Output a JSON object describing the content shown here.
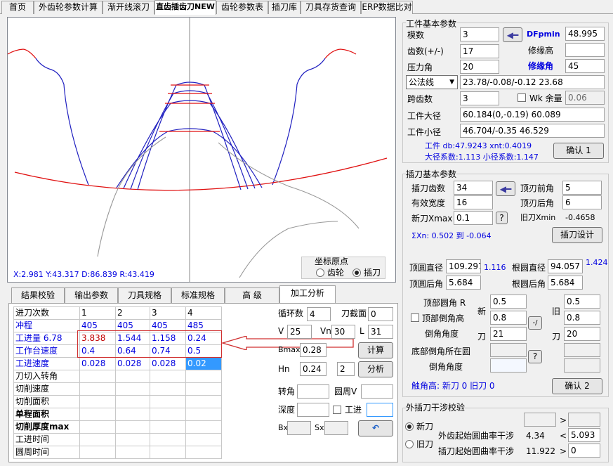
{
  "tabs": [
    "首页",
    "外齿轮参数计算",
    "渐开线滚刀",
    "直齿插齿刀NEW",
    "齿轮参数表",
    "插刀库",
    "刀具存货查询",
    "ERP数据比对"
  ],
  "canvas": {
    "coords_label": "X:2.981  Y:43.317  D:86.839  R:43.419",
    "origin_title": "坐标原点",
    "origin_gear": "齿轮",
    "origin_cutter": "插刀"
  },
  "bottom_tabs": [
    "结果校验",
    "输出参数",
    "刀具规格",
    "标准规格",
    "高 级",
    "加工分析"
  ],
  "table": {
    "headers": [
      "进刀次数",
      "1",
      "2",
      "3",
      "4"
    ],
    "rows": [
      {
        "label": "冲程",
        "values": [
          "405",
          "405",
          "405",
          "485"
        ]
      },
      {
        "label": "工进量 6.78",
        "values": [
          "3.838",
          "1.544",
          "1.158",
          "0.24"
        ]
      },
      {
        "label": "工作台速度",
        "values": [
          "0.4",
          "0.64",
          "0.74",
          "0.5"
        ]
      },
      {
        "label": "工进速度",
        "values": [
          "0.028",
          "0.028",
          "0.028",
          "0.02"
        ]
      },
      {
        "label": "刀切入转角",
        "values": [
          "",
          "",
          "",
          ""
        ]
      },
      {
        "label": "切削速度",
        "values": [
          "",
          "",
          "",
          ""
        ]
      },
      {
        "label": "切削面积",
        "values": [
          "",
          "",
          "",
          ""
        ]
      },
      {
        "label": "单程面积",
        "values": [
          "",
          "",
          "",
          ""
        ]
      },
      {
        "label": "切削厚度max",
        "values": [
          "",
          "",
          "",
          ""
        ]
      },
      {
        "label": "工进时间",
        "values": [
          "",
          "",
          "",
          ""
        ]
      },
      {
        "label": "圆周时间",
        "values": [
          "",
          "",
          "",
          ""
        ]
      }
    ]
  },
  "analysis": {
    "cycles_label": "循环数",
    "cycles": "4",
    "section_label": "刀截面",
    "section": "0",
    "v_label": "V",
    "v": "25",
    "vn_label": "Vn",
    "vn": "30",
    "l_label": "L",
    "l": "31",
    "bmax_label": "Bmax",
    "bmax": "0.28",
    "calc_btn": "计算",
    "hn_label": "Hn",
    "hn": "0.24",
    "hn2": "2",
    "analyze_btn": "分析",
    "angle_label": "转角",
    "circ_label": "圆周V",
    "depth_label": "深度",
    "feed_label": "工进",
    "bx_label": "Bx",
    "sx_label": "Sx"
  },
  "workpiece": {
    "title": "工件基本参数",
    "module_label": "模数",
    "module": "3",
    "dfpmin_label": "DFpmin",
    "dfpmin": "48.995",
    "teeth_label": "齿数(+/-)",
    "teeth": "17",
    "mod_height_label": "修缘高",
    "mod_height": "",
    "pressure_label": "压力角",
    "pressure": "20",
    "mod_angle_label": "修缘角",
    "mod_angle": "45",
    "normal_select": "公法线",
    "normal_value": "23.78/-0.08/-0.12  23.68",
    "span_label": "跨齿数",
    "span": "3",
    "wk_label": "Wk 余量",
    "wk": "0.06",
    "od_label": "工件大径",
    "od": "60.184(0,-0.19)  60.089",
    "id_label": "工件小径",
    "id": "46.704/-0.35  46.529",
    "info1": "工件  db:47.9243 xnt:0.4019",
    "info2": "大径系数:1.113 小径系数:1.147",
    "confirm": "确认 1"
  },
  "cutter": {
    "title": "插刀基本参数",
    "teeth_label": "插刀齿数",
    "teeth": "34",
    "rake_label": "顶刃前角",
    "rake": "5",
    "width_label": "有效宽度",
    "width": "16",
    "relief_label": "顶刃后角",
    "relief": "6",
    "xmax_label": "新刀Xmax",
    "xmax": "0.1",
    "q": "?",
    "old_xmin_label": "旧刀Xmin",
    "old_xmin": "-0.4658",
    "sum_label": "ΣXn:  0.502 到 -0.064",
    "design_btn": "插刀设计",
    "tip_dia_label": "顶圆直径",
    "tip_dia": "109.297",
    "tip_ratio": "1.116",
    "root_dia_label": "根圆直径",
    "root_dia": "94.057",
    "root_ratio": "1.424",
    "tip_back_label": "顶圆后角",
    "tip_back": "5.684",
    "root_back_label": "根圆后角",
    "root_back": "5.684",
    "tip_r_label": "顶部圆角  R",
    "new_label": "新",
    "old_label": "旧",
    "tip_r_new": "0.5",
    "tip_r_old": "0.5",
    "tip_chamfer_label": "顶部倒角高",
    "tip_chamfer_new": "0.8",
    "tip_chamfer_old": "0.8",
    "chamfer_angle_label": "倒角角度",
    "knife_label": "刀",
    "chamfer_angle_new": "21",
    "chamfer_angle_old": "20",
    "bottom_chamfer_label": "底部倒角所在圆",
    "bottom_angle_label": "倒角角度",
    "contact_label": "触角高: 新刀 0   旧刀 0",
    "confirm": "确认 2"
  },
  "interference": {
    "title": "外插刀干涉校验",
    "new_cutter": "新刀",
    "old_cutter": "旧刀",
    "ext_label": "外齿起始圆曲率干涉",
    "ext_value": "4.34",
    "ext_op": "<",
    "ext_result": "5.093",
    "cut_label": "插刀起始圆曲率干涉",
    "cut_value": "11.922",
    "cut_op": ">",
    "cut_result": "0",
    "top_op": ">"
  }
}
